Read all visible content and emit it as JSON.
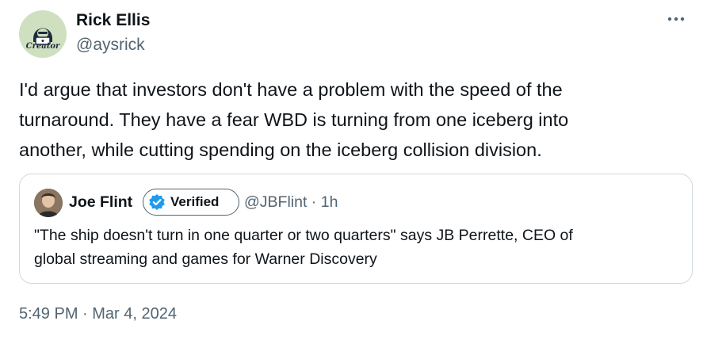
{
  "author": {
    "name": "Rick Ellis",
    "handle": "@aysrick",
    "avatar_badge": "Creator"
  },
  "tweet": {
    "text_lines": [
      "I'd argue that investors don't have a problem with the speed of the",
      "turnaround. They have a fear WBD is turning from one iceberg into",
      "another, while cutting spending on the iceberg collision division."
    ],
    "timestamp": "5:49 PM · Mar 4, 2024"
  },
  "quote": {
    "name": "Joe Flint",
    "verified_label": "Verified",
    "handle_time": "@JBFlint · 1h",
    "text_lines": [
      "\"The ship doesn't turn in one quarter or two quarters\" says JB Perrette, CEO of",
      "global streaming and games for Warner Discovery"
    ]
  },
  "icons": {
    "more": "more-horizontal-icon",
    "verified": "verified-badge-icon"
  },
  "colors": {
    "verified_blue": "#1d9bf0",
    "text_primary": "#0f1419",
    "text_secondary": "#536471",
    "border": "#cfd9de"
  }
}
